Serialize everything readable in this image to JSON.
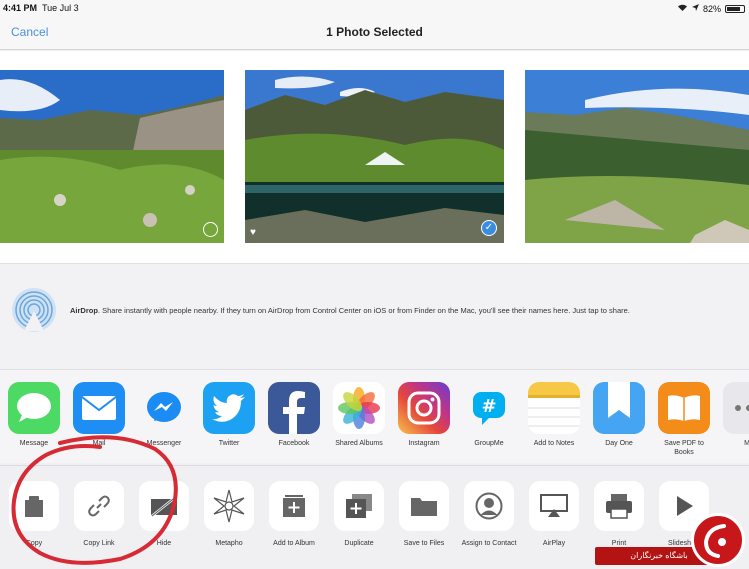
{
  "status_bar": {
    "time": "4:41 PM",
    "date": "Tue Jul 3",
    "battery": "82%"
  },
  "nav": {
    "cancel_label": "Cancel",
    "title": "1 Photo Selected"
  },
  "airdrop": {
    "title": "AirDrop",
    "description": ". Share instantly with people nearby. If they turn on AirDrop from Control Center on iOS or from Finder on the Mac, you'll see their names here. Just tap to share."
  },
  "apps": [
    {
      "label": "Message",
      "icon": "messages-icon",
      "color": "#4cd964"
    },
    {
      "label": "Mail",
      "icon": "mail-icon",
      "color": "#1e8ef5"
    },
    {
      "label": "Messenger",
      "icon": "messenger-icon",
      "color": "#ffffff"
    },
    {
      "label": "Twitter",
      "icon": "twitter-icon",
      "color": "#1da1f2"
    },
    {
      "label": "Facebook",
      "icon": "facebook-icon",
      "color": "#3b5998"
    },
    {
      "label": "Shared Albums",
      "icon": "photos-icon",
      "color": "#ffffff"
    },
    {
      "label": "Instagram",
      "icon": "instagram-icon",
      "color": "#c13584"
    },
    {
      "label": "GroupMe",
      "icon": "groupme-icon",
      "color": "#ffffff"
    },
    {
      "label": "Add to Notes",
      "icon": "notes-icon",
      "color": "#ffffff"
    },
    {
      "label": "Day One",
      "icon": "day-one-icon",
      "color": "#45a5f3"
    },
    {
      "label": "Save PDF to Books",
      "icon": "books-icon",
      "color": "#f48c1a"
    },
    {
      "label": "Mo",
      "icon": "more-icon",
      "color": "#e8e8ec"
    }
  ],
  "actions": [
    {
      "label": "Copy",
      "icon": "copy-icon"
    },
    {
      "label": "Copy Link",
      "icon": "link-icon"
    },
    {
      "label": "Hide",
      "icon": "hide-icon"
    },
    {
      "label": "Metapho",
      "icon": "metapho-icon"
    },
    {
      "label": "Add to Album",
      "icon": "add-to-album-icon"
    },
    {
      "label": "Duplicate",
      "icon": "duplicate-icon"
    },
    {
      "label": "Save to Files",
      "icon": "folder-icon"
    },
    {
      "label": "Assign to Contact",
      "icon": "contact-icon"
    },
    {
      "label": "AirPlay",
      "icon": "airplay-icon"
    },
    {
      "label": "Print",
      "icon": "printer-icon"
    },
    {
      "label": "Slideshow",
      "icon": "play-icon"
    }
  ],
  "watermark": {
    "text": "باشگاه خبرنگاران"
  }
}
